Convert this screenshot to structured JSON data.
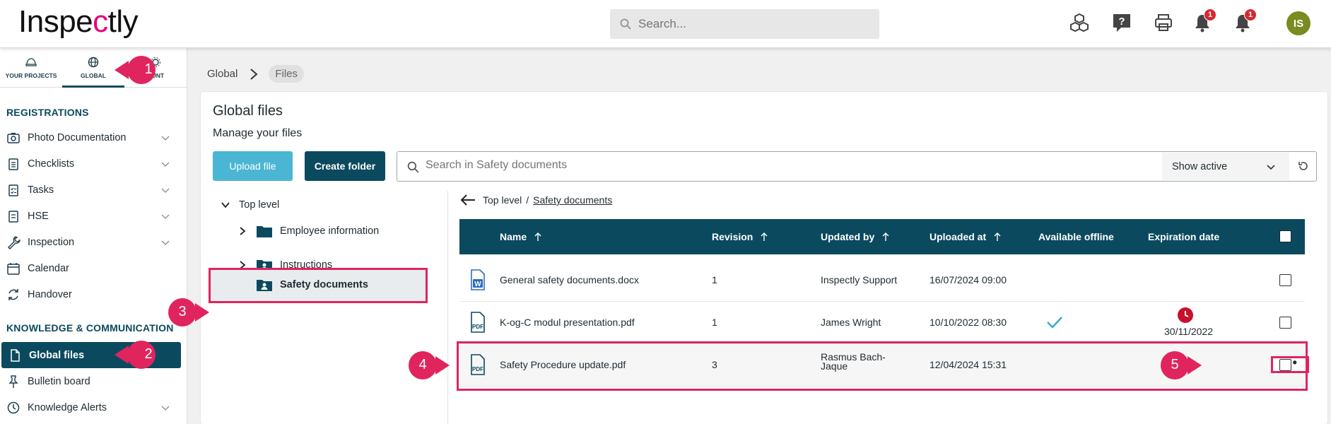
{
  "app": {
    "logo_pre": "Inspe",
    "logo_c": "c",
    "logo_post": "tly"
  },
  "topbar": {
    "search_placeholder": "Search...",
    "avatar_initials": "IS",
    "notification_count": "1",
    "alert_count": "1",
    "icons": [
      "cubes-icon",
      "help-icon",
      "printer-icon",
      "bell-icon",
      "alert-bell-icon"
    ]
  },
  "sidebar": {
    "tabs": [
      {
        "label": "YOUR PROJECTS",
        "icon": "helmet-icon"
      },
      {
        "label": "GLOBAL",
        "icon": "globe-icon",
        "active": true
      },
      {
        "label": "OUNT",
        "icon": "gear-icon"
      }
    ],
    "sections": [
      {
        "title": "REGISTRATIONS",
        "items": [
          {
            "label": "Photo Documentation",
            "icon": "camera-icon",
            "expandable": true
          },
          {
            "label": "Checklists",
            "icon": "checklist-icon",
            "expandable": true
          },
          {
            "label": "Tasks",
            "icon": "tasks-icon",
            "expandable": true
          },
          {
            "label": "HSE",
            "icon": "hse-icon",
            "expandable": true
          },
          {
            "label": "Inspection",
            "icon": "wrench-icon",
            "expandable": true
          },
          {
            "label": "Calendar",
            "icon": "calendar-icon",
            "expandable": false
          },
          {
            "label": "Handover",
            "icon": "handover-icon",
            "expandable": false
          }
        ]
      },
      {
        "title": "KNOWLEDGE & COMMUNICATION",
        "items": [
          {
            "label": "Global files",
            "icon": "file-icon",
            "active": true
          },
          {
            "label": "Bulletin board",
            "icon": "pin-icon",
            "expandable": false
          },
          {
            "label": "Knowledge Alerts",
            "icon": "alert-clock-icon",
            "expandable": true
          }
        ]
      }
    ]
  },
  "breadcrumb": {
    "root": "Global",
    "current": "Files"
  },
  "main": {
    "title": "Global files",
    "subtitle": "Manage your files",
    "upload_label": "Upload file",
    "create_folder_label": "Create folder",
    "search_placeholder": "Search in Safety documents",
    "filter_value": "Show active"
  },
  "tree": {
    "root": "Top level",
    "folders": [
      {
        "label": "Employee information",
        "icon": "folder-icon"
      },
      {
        "label": "Instructions",
        "icon": "user-folder-icon"
      },
      {
        "label": "Safety documents",
        "icon": "user-folder-icon",
        "selected": true
      }
    ]
  },
  "files": {
    "path_root": "Top level",
    "path_sep": "/",
    "path_current": "Safety documents",
    "columns": [
      "Name",
      "Revision",
      "Updated by",
      "Uploaded at",
      "Available offline",
      "Expiration date"
    ],
    "rows": [
      {
        "name": "General safety documents.docx",
        "revision": "1",
        "updated_by": "Inspectly Support",
        "uploaded_at": "16/07/2024 09:00",
        "type": "word",
        "offline": false,
        "expiration": ""
      },
      {
        "name": "K-og-C modul presentation.pdf",
        "revision": "1",
        "updated_by": "James Wright",
        "uploaded_at": "10/10/2022 08:30",
        "type": "pdf",
        "offline": true,
        "expiration": "30/11/2022"
      },
      {
        "name": "Safety Procedure update.pdf",
        "revision": "3",
        "updated_by": "Rasmus Bach-Jaque",
        "uploaded_at": "12/04/2024 15:31",
        "type": "pdf",
        "offline": false,
        "expiration": ""
      }
    ],
    "more_label": "•••",
    "pdf_label": "PDF",
    "word_label": "W"
  },
  "steps": [
    "1",
    "2",
    "3",
    "4",
    "5"
  ],
  "colors": {
    "primary": "#0b4a5e",
    "accent": "#4bb6d4",
    "highlight": "#e0245e",
    "badge": "#d7282f"
  }
}
